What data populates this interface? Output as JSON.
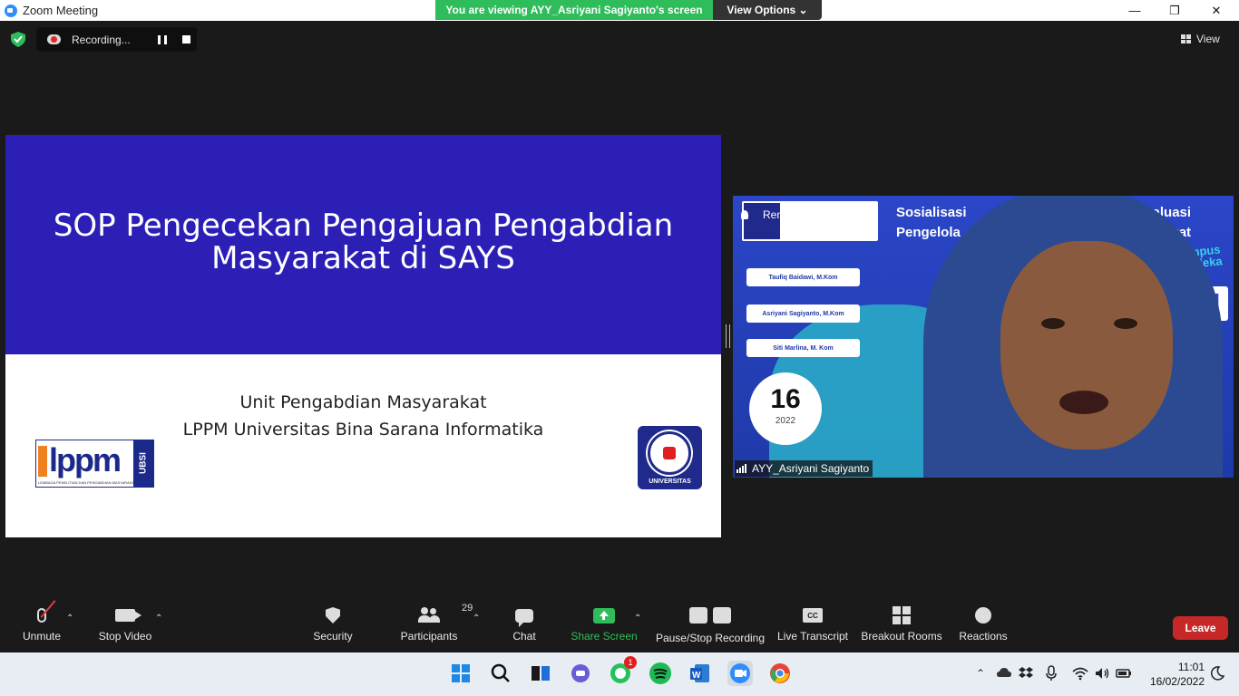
{
  "window": {
    "title": "Zoom Meeting",
    "minimize": "—",
    "maximize": "❐",
    "close": "✕"
  },
  "banner": {
    "viewing_text": "You are viewing AYY_Asriyani Sagiyanto's screen",
    "view_options": "View Options ⌄"
  },
  "recording": {
    "label": "Recording..."
  },
  "view_button": {
    "label": "View"
  },
  "slide": {
    "title_line1": "SOP Pengecekan Pengajuan Pengabdian",
    "title_line2": "Masyarakat di SAYS",
    "subtitle_line1": "Unit Pengabdian Masyarakat",
    "subtitle_line2": "LPPM Universitas Bina Sarana Informatika",
    "left_logo_text": "lppm",
    "left_logo_side": "UBSI",
    "left_logo_caption": "LEMBAGA PENELITIAN DAN PENGABDIAN MASYARAKAT",
    "right_logo_label": "UNIVERSITAS"
  },
  "video": {
    "remove_spotlight": "Remove Spotlight",
    "participant_name": "AYY_Asriyani Sagiyanto",
    "bg_header_left": "Sosialisasi",
    "bg_header_left2": "Pengelola",
    "bg_header_right": "dan Evaluasi",
    "bg_header_right2": "n Masyarakat",
    "bg_kampus": "Kampus Merdeka",
    "bg_ppm": "PPM",
    "bg_card1": "Taufiq Baidawi, M.Kom",
    "bg_card2": "Asriyani Sagiyanto, M.Kom",
    "bg_card3": "Siti Marlina, M. Kom",
    "bg_day": "16",
    "bg_month": "2022"
  },
  "toolbar": {
    "unmute": "Unmute",
    "stop_video": "Stop Video",
    "security": "Security",
    "participants": "Participants",
    "participants_count": "29",
    "chat": "Chat",
    "share_screen": "Share Screen",
    "pause_stop_recording": "Pause/Stop Recording",
    "live_transcript": "Live Transcript",
    "cc": "CC",
    "breakout_rooms": "Breakout Rooms",
    "reactions": "Reactions",
    "leave": "Leave",
    "caret": "⌃"
  },
  "taskbar": {
    "whatsapp_badge": "1",
    "time": "11:01",
    "date": "16/02/2022",
    "tray_up": "⌃"
  },
  "colors": {
    "share_green": "#2ebd5a",
    "leave_red": "#c62828",
    "slide_blue": "#2b1fb6"
  }
}
